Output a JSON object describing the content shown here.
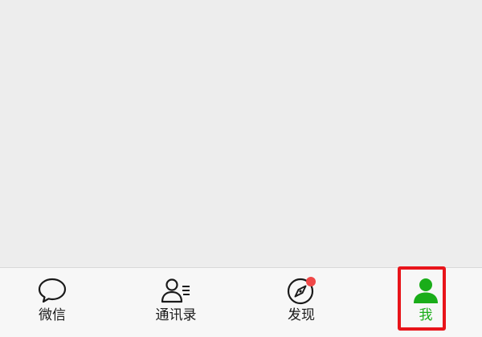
{
  "tab_bar": {
    "tabs": [
      {
        "label": "微信",
        "icon": "chat-bubble-icon",
        "active": false
      },
      {
        "label": "通讯录",
        "icon": "contacts-icon",
        "active": false
      },
      {
        "label": "发现",
        "icon": "compass-icon",
        "active": false,
        "badge": "red-dot"
      },
      {
        "label": "我",
        "icon": "person-icon",
        "active": true
      }
    ]
  },
  "colors": {
    "accent": "#1aad19",
    "badge": "#f04848",
    "highlight": "#e8141a",
    "background": "#ededed",
    "tab_bar_bg": "#f7f7f7"
  }
}
